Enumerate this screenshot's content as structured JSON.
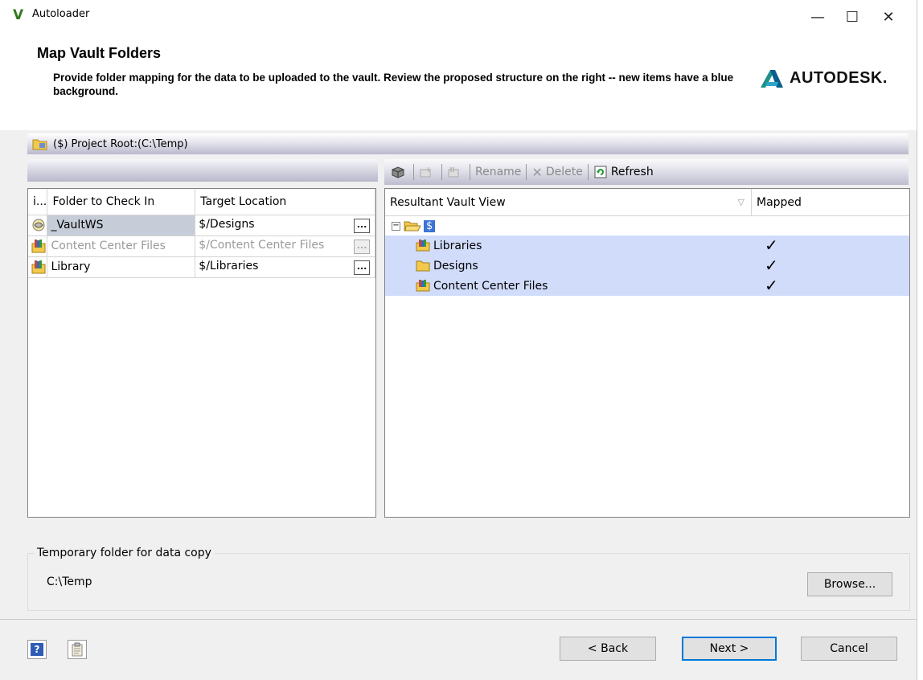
{
  "window": {
    "title": "Autoloader",
    "app_icon": "V",
    "controls": {
      "minimize": "minimize-icon",
      "maximize": "maximize-icon",
      "close": "close-icon"
    }
  },
  "header": {
    "title": "Map Vault Folders",
    "description": "Provide folder mapping for the data to be uploaded to the vault. Review the proposed structure on the right -- new items have a blue background.",
    "logo_text": "AUTODESK."
  },
  "project_root": "($) Project Root:(C:\\Temp)",
  "left_grid": {
    "columns": [
      "i...",
      "Folder to Check In",
      "Target Location"
    ],
    "rows": [
      {
        "folder": "_VaultWS",
        "target": "$/Designs",
        "selected": true,
        "disabled": false,
        "icon": "workspace-icon"
      },
      {
        "folder": "Content Center Files",
        "target": "$/Content Center Files",
        "selected": false,
        "disabled": true,
        "icon": "library-folder-icon"
      },
      {
        "folder": "Library",
        "target": "$/Libraries",
        "selected": false,
        "disabled": false,
        "icon": "library-folder-icon"
      }
    ],
    "ellipsis": "..."
  },
  "toolbar": {
    "rename": "Rename",
    "delete": "Delete",
    "refresh": "Refresh"
  },
  "tree": {
    "columns": [
      "Resultant Vault View",
      "Mapped"
    ],
    "root": "$",
    "items": [
      {
        "name": "Libraries",
        "mapped": "✓"
      },
      {
        "name": "Designs",
        "mapped": "✓"
      },
      {
        "name": "Content Center Files",
        "mapped": "✓"
      }
    ]
  },
  "temp_folder": {
    "label": "Temporary folder for data copy",
    "path": "C:\\Temp",
    "browse": "Browse..."
  },
  "footer": {
    "back": "< Back",
    "next": "Next >",
    "cancel": "Cancel"
  }
}
